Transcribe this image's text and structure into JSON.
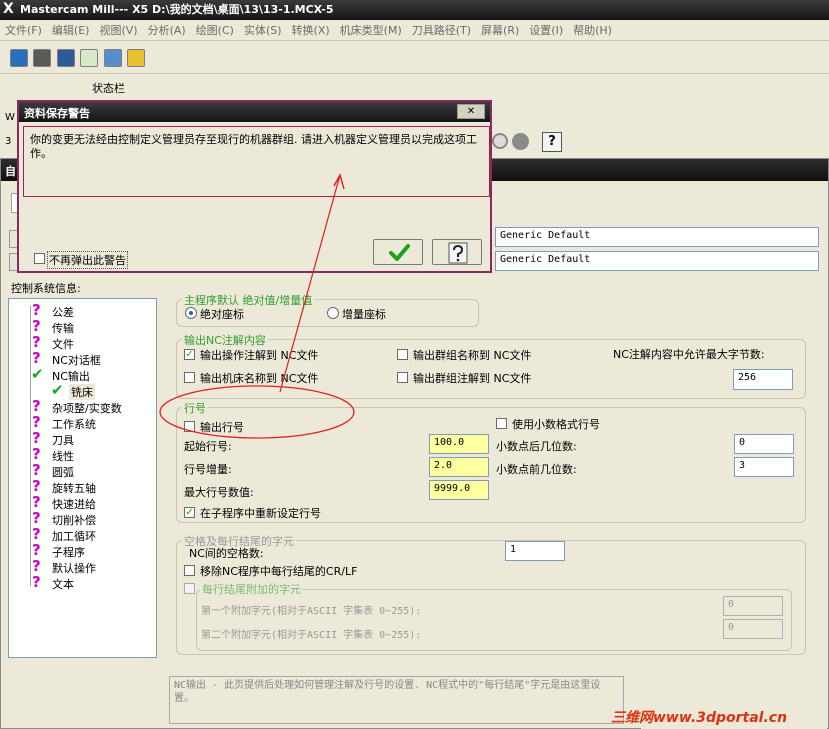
{
  "app": {
    "title": "Mastercam Mill--- X5  D:\\我的文档\\桌面\\13\\13-1.MCX-5",
    "menu": [
      "文件(F)",
      "编辑(E)",
      "视图(V)",
      "分析(A)",
      "绘图(C)",
      "实体(S)",
      "转换(X)",
      "机床类型(M)",
      "刀具路径(T)",
      "屏幕(R)",
      "设置(I)",
      "帮助(H)"
    ],
    "statusbar_label": "状态栏"
  },
  "warning_dialog": {
    "title": "资料保存警告",
    "close_glyph": "✕",
    "message": "你的变更无法经由控制定义管理员存至现行的机器群组. 请进入机器定义管理员以完成这项工作。",
    "no_popup_label": "不再弹出此警告",
    "no_popup_checked": false,
    "ok_icon": "check-icon",
    "help_icon": "question-icon"
  },
  "settings_dialog": {
    "title_char": "自",
    "path_field_1": "Generic Default",
    "path_field_2": "Generic Default",
    "tree_label": "控制系统信息:",
    "tree_items": [
      {
        "label": "公差",
        "icon": "question-icon"
      },
      {
        "label": "传输",
        "icon": "question-icon"
      },
      {
        "label": "文件",
        "icon": "question-icon"
      },
      {
        "label": "NC对话框",
        "icon": "question-icon"
      },
      {
        "label": "NC输出",
        "icon": "check-icon"
      },
      {
        "label": "铣床",
        "icon": "check-icon"
      },
      {
        "label": "杂项整/实变数",
        "icon": "question-icon"
      },
      {
        "label": "工作系统",
        "icon": "question-icon"
      },
      {
        "label": "刀具",
        "icon": "question-icon"
      },
      {
        "label": "线性",
        "icon": "question-icon"
      },
      {
        "label": "圆弧",
        "icon": "question-icon"
      },
      {
        "label": "旋转五轴",
        "icon": "question-icon"
      },
      {
        "label": "快速进给",
        "icon": "question-icon"
      },
      {
        "label": "切削补偿",
        "icon": "question-icon"
      },
      {
        "label": "加工循环",
        "icon": "question-icon"
      },
      {
        "label": "子程序",
        "icon": "question-icon"
      },
      {
        "label": "默认操作",
        "icon": "question-icon"
      },
      {
        "label": "文本",
        "icon": "question-icon"
      }
    ],
    "main_program": {
      "title": "主程序默认 绝对值/增量值",
      "absolute_label": "绝对座标",
      "incremental_label": "增量座标",
      "selected": "absolute"
    },
    "nc_comment": {
      "title": "输出NC注解内容",
      "op_comment_label": "输出操作注解到 NC文件",
      "op_comment_checked": true,
      "group_name_label": "输出群组名称到 NC文件",
      "group_name_checked": false,
      "machine_name_label": "输出机床名称到 NC文件",
      "machine_name_checked": false,
      "group_comment_label": "输出群组注解到 NC文件",
      "group_comment_checked": false,
      "max_chars_label": "NC注解内容中允许最大字节数:",
      "max_chars_value": "256"
    },
    "line_number": {
      "title": "行号",
      "output_label": "输出行号",
      "output_checked": false,
      "decimal_format_label": "使用小数格式行号",
      "decimal_format_checked": false,
      "start_label": "起始行号:",
      "start_value": "100.0",
      "increment_label": "行号增量:",
      "increment_value": "2.0",
      "max_label": "最大行号数值:",
      "max_value": "9999.0",
      "after_decimal_label": "小数点后几位数:",
      "after_decimal_value": "0",
      "before_decimal_label": "小数点前几位数:",
      "before_decimal_value": "3",
      "reset_sub_label": "在子程序中重新设定行号",
      "reset_sub_checked": true
    },
    "spaces": {
      "title": "空格及每行结尾的字元",
      "nc_spaces_label": "NC间的空格数:",
      "nc_spaces_value": "1",
      "remove_crlf_label": "移除NC程序中每行结尾的CR/LF",
      "remove_crlf_checked": false,
      "eol_chars_label": "每行结尾附加的字元",
      "eol_chars_checked": false,
      "first_char_label": "第一个附加字元(相对于ASCII 字集表 0~255):",
      "first_char_value": "0",
      "second_char_label": "第二个附加字元(相对于ASCII 字集表 0~255):",
      "second_char_value": "0"
    },
    "help_text": "NC输出 - 此页提供后处理如何管理注解及行号的设置. NC程式中的\"每行结尾\"字元是由这里设置。",
    "watermark": "三维网www.3dportal.cn"
  },
  "colors": {
    "title_bar": "#1e1e1e",
    "annotation_red": "#e02020",
    "group_title_green": "#2e9e2e",
    "highlight_field": "#ffffa0",
    "question_icon": "#cc00cc"
  }
}
